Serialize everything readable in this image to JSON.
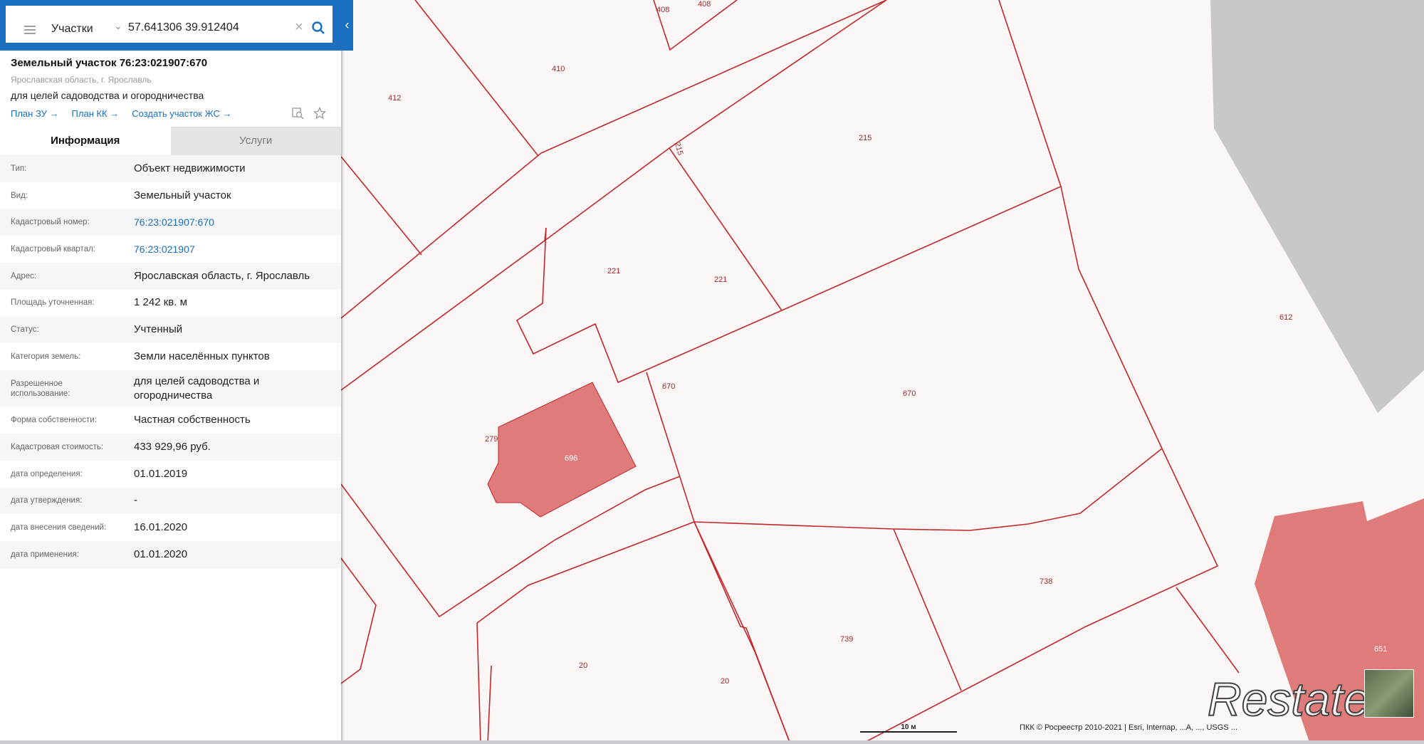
{
  "search": {
    "layer": "Участки",
    "query": "57.641306 39.912404"
  },
  "parcel": {
    "title": "Земельный участок 76:23:021907:670",
    "region": "Ярославская область, г. Ярославль",
    "purpose": "для целей садоводства и огородничества",
    "links": [
      "План ЗУ →",
      "План КК →",
      "Создать участок ЖС →"
    ]
  },
  "tabs": [
    "Информация",
    "Услуги"
  ],
  "info_rows": [
    {
      "key": "Тип:",
      "value": "Объект недвижимости"
    },
    {
      "key": "Вид:",
      "value": "Земельный участок"
    },
    {
      "key": "Кадастровый номер:",
      "value": "76:23:021907:670",
      "link": true
    },
    {
      "key": "Кадастровый квартал:",
      "value": "76:23:021907",
      "link": true
    },
    {
      "key": "Адрес:",
      "value": "Ярославская область, г. Ярославль"
    },
    {
      "key": "Площадь уточненная:",
      "value": "1 242 кв. м"
    },
    {
      "key": "Статус:",
      "value": "Учтенный"
    },
    {
      "key": "Категория земель:",
      "value": "Земли населённых пунктов"
    },
    {
      "key": "Разрешенное использование:",
      "value": "для целей садоводства и огородничества",
      "tall": true
    },
    {
      "key": "Форма собственности:",
      "value": "Частная собственность"
    },
    {
      "key": "Кадастровая стоимость:",
      "value": "433 929,96 руб."
    },
    {
      "key": "дата определения:",
      "value": "01.01.2019"
    },
    {
      "key": "дата утверждения:",
      "value": "-"
    },
    {
      "key": "дата внесения сведений:",
      "value": "16.01.2020"
    },
    {
      "key": "дата применения:",
      "value": "01.01.2020"
    }
  ],
  "map": {
    "parcel_labels": [
      "408",
      "408",
      "410",
      "412",
      "215",
      "215",
      "221",
      "221",
      "670",
      "670",
      "279",
      "696",
      "612",
      "738",
      "739",
      "20",
      "20",
      "651"
    ],
    "scale_label": "10 м",
    "attribution": "ПКК © Росреестр 2010-2021 | Esri, Internap, ...A, ..., USGS ...",
    "watermark": "Restate",
    "colors": {
      "boundary": "#c0282d",
      "building": "#e07b7b",
      "panel_accent": "#1a6fc0"
    }
  },
  "icons": [
    "menu-icon",
    "chevron-down-icon",
    "clear-icon",
    "search-icon",
    "collapse-chevron-icon",
    "zoom-to-icon",
    "star-icon"
  ]
}
